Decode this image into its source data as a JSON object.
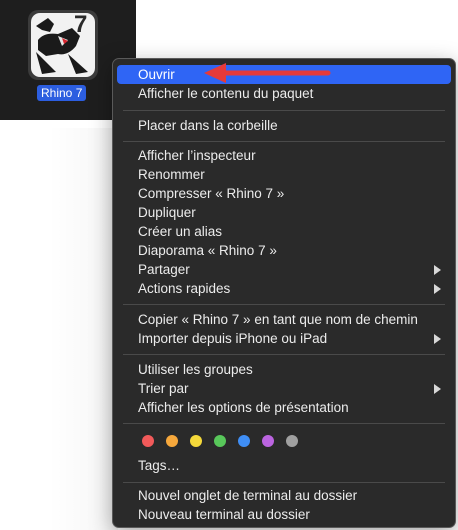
{
  "app": {
    "label": "Rhino 7",
    "icon": "rhino-7-app-icon",
    "icon_digit": "7"
  },
  "menu": {
    "open": "Ouvrir",
    "show_package_contents": "Afficher le contenu du paquet",
    "move_to_trash": "Placer dans la corbeille",
    "get_info": "Afficher l’inspecteur",
    "rename": "Renommer",
    "compress": "Compresser « Rhino 7 »",
    "duplicate": "Dupliquer",
    "make_alias": "Créer un alias",
    "quick_look": "Diaporama « Rhino 7 »",
    "share": "Partager",
    "quick_actions": "Actions rapides",
    "copy_as_pathname": "Copier « Rhino 7 » en tant que nom de chemin",
    "import_from_iphone": "Importer depuis iPhone ou iPad",
    "use_groups": "Utiliser les groupes",
    "sort_by": "Trier par",
    "show_view_options": "Afficher les options de présentation",
    "tags": "Tags…",
    "new_terminal_tab": "Nouvel onglet de terminal au dossier",
    "new_terminal": "Nouveau terminal au dossier"
  },
  "tag_colors": [
    "#f25a5a",
    "#f6a83c",
    "#f5d93a",
    "#58c75a",
    "#3f8ef5",
    "#bb64e0",
    "#a0a0a0"
  ],
  "colors": {
    "selection": "#2f65f5",
    "menu_background": "#2a2a2a",
    "annotation_arrow": "#e63a3a"
  }
}
